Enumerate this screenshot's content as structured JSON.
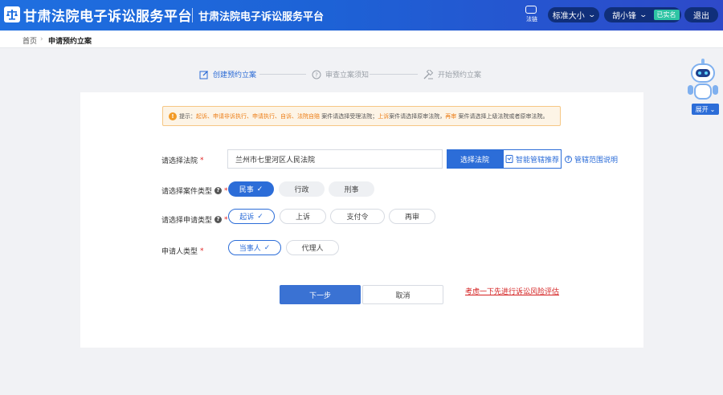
{
  "header": {
    "brand_title": "甘肃法院电子诉讼服务平台",
    "sub_title": "甘肃法院电子诉讼服务平台",
    "fc_label": "法链",
    "font_size_label": "标准大小",
    "user_name": "胡小锋",
    "verified_badge": "已实名",
    "logout_label": "退出",
    "colors": {
      "primary": "#1f6fe0",
      "pill": "#102f7a",
      "verified": "#2ec4a4"
    }
  },
  "breadcrumb": {
    "home": "首页",
    "separator": "›",
    "current": "申请预约立案"
  },
  "steps": [
    {
      "label": "创建预约立案",
      "icon": "edit-icon",
      "active": true
    },
    {
      "label": "审查立案须知",
      "icon": "question-circle-icon",
      "active": false
    },
    {
      "label": "开始预约立案",
      "icon": "gavel-icon",
      "active": false
    }
  ],
  "notice": {
    "prefix": "提示：",
    "highlight1": "起诉、申请非诉执行、申请执行、自诉、法院自赔",
    "mid1": " 案件请选择受理法院；",
    "highlight2": "上诉",
    "mid2": "案件请选择原审法院，",
    "highlight3": "再审",
    "tail": " 案件请选择上级法院或者原审法院。"
  },
  "form": {
    "court": {
      "label": "请选择法院",
      "required_mark": "*",
      "value": "兰州市七里河区人民法院",
      "select_button": "选择法院",
      "smart_button": "智能管辖推荐",
      "scope_link": "管辖范围说明"
    },
    "case_type": {
      "label": "请选择案件类型",
      "required_mark": "*",
      "options": [
        "民事",
        "行政",
        "刑事"
      ],
      "selected": "民事"
    },
    "apply_type": {
      "label": "请选择申请类型",
      "required_mark": "*",
      "options": [
        "起诉",
        "上诉",
        "支付令",
        "再审"
      ],
      "selected": "起诉"
    },
    "applicant_type": {
      "label": "申请人类型",
      "required_mark": "*",
      "options": [
        "当事人",
        "代理人"
      ],
      "selected": "当事人"
    }
  },
  "actions": {
    "next": "下一步",
    "cancel": "取消",
    "risk_link": "考虑一下先进行诉讼风险评估"
  },
  "assistant": {
    "expand_label": "展开",
    "icon": "robot-assistant-icon"
  }
}
